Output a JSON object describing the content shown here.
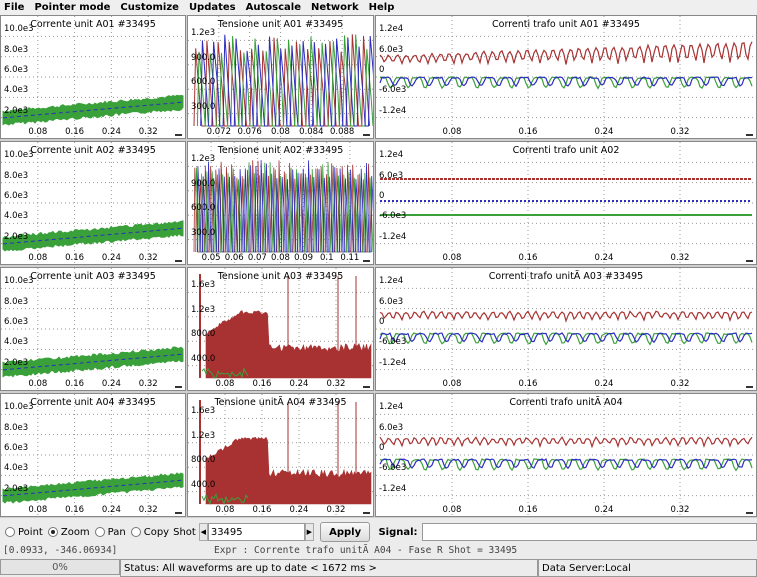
{
  "menu": [
    "File",
    "Pointer mode",
    "Customize",
    "Updates",
    "Autoscale",
    "Network",
    "Help"
  ],
  "colors": {
    "red": "#a83232",
    "green": "#3aa03a",
    "blue": "#2c2cc0",
    "grid": "#999999"
  },
  "plots": [
    {
      "title": "Corrente unit A01  #33495",
      "yticks": [
        "10.0e3",
        "8.0e3",
        "6.0e3",
        "4.0e3",
        "2.0e3"
      ],
      "xticks": [
        "0.08",
        "0.16",
        "0.24",
        "0.32"
      ],
      "kind": "band"
    },
    {
      "title": "Tensione unit A01  #33495",
      "yticks": [
        "1.2e3",
        "900.0",
        "600.0",
        "300.0"
      ],
      "xticks": [
        "0.072",
        "0.076",
        "0.08",
        "0.084",
        "0.088"
      ],
      "kind": "volt1"
    },
    {
      "title": "Correnti trafo unit A01  #33495",
      "yticks": [
        "1.2e4",
        "6.0e3",
        "0",
        "-6.0e3",
        "-1.2e4"
      ],
      "xticks": [
        "0.08",
        "0.16",
        "0.24",
        "0.32"
      ],
      "kind": "trafo"
    },
    {
      "title": "Corrente unit A02  #33495",
      "yticks": [
        "10.0e3",
        "8.0e3",
        "6.0e3",
        "4.0e3",
        "2.0e3"
      ],
      "xticks": [
        "0.08",
        "0.16",
        "0.24",
        "0.32"
      ],
      "kind": "band"
    },
    {
      "title": "Tensione unit A02  #33495",
      "yticks": [
        "1.2e3",
        "900.0",
        "600.0",
        "300.0"
      ],
      "xticks": [
        "0.05",
        "0.06",
        "0.07",
        "0.08",
        "0.09",
        "0.1",
        "0.11"
      ],
      "kind": "volt2"
    },
    {
      "title": "Correnti trafo unit A02",
      "yticks": [
        "1.2e4",
        "6.0e3",
        "0",
        "-6.0e3",
        "-1.2e4"
      ],
      "xticks": [
        "0.08",
        "0.16",
        "0.24",
        "0.32"
      ],
      "kind": "flat"
    },
    {
      "title": "Corrente unit A03  #33495",
      "yticks": [
        "10.0e3",
        "8.0e3",
        "6.0e3",
        "4.0e3",
        "2.0e3"
      ],
      "xticks": [
        "0.08",
        "0.16",
        "0.24",
        "0.32"
      ],
      "kind": "band"
    },
    {
      "title": "Tensione unit A03  #33495",
      "yticks": [
        "1.6e3",
        "1.2e3",
        "800.0",
        "400.0"
      ],
      "xticks": [
        "0.08",
        "0.16",
        "0.24",
        "0.32"
      ],
      "kind": "volt3"
    },
    {
      "title": "Correnti trafo unitÃ  A03  #33495",
      "yticks": [
        "1.2e4",
        "6.0e3",
        "0",
        "-6.0e3",
        "-1.2e4"
      ],
      "xticks": [
        "0.08",
        "0.16",
        "0.24",
        "0.32"
      ],
      "kind": "trafo2"
    },
    {
      "title": "Corrente unit A04  #33495",
      "yticks": [
        "10.0e3",
        "8.0e3",
        "6.0e3",
        "4.0e3",
        "2.0e3"
      ],
      "xticks": [
        "0.08",
        "0.16",
        "0.24",
        "0.32"
      ],
      "kind": "band"
    },
    {
      "title": "Tensione unitÃ  A04  #33495",
      "yticks": [
        "1.6e3",
        "1.2e3",
        "800.0",
        "400.0"
      ],
      "xticks": [
        "0.08",
        "0.16",
        "0.24",
        "0.32"
      ],
      "kind": "volt3"
    },
    {
      "title": "Correnti trafo unitÃ  A04",
      "yticks": [
        "1.2e4",
        "6.0e3",
        "0",
        "-6.0e3",
        "-1.2e4"
      ],
      "xticks": [
        "0.08",
        "0.16",
        "0.24",
        "0.32"
      ],
      "kind": "trafo2"
    }
  ],
  "controls": {
    "modes": [
      "Point",
      "Zoom",
      "Pan",
      "Copy"
    ],
    "selected_mode": "Zoom",
    "shot_label": "Shot",
    "shot_value": "33495",
    "apply_label": "Apply",
    "signal_label": "Signal:",
    "signal_value": ""
  },
  "info": {
    "coords": "[0.0933, -346.06934]",
    "expr": "Expr : Corrente trafo unitÃ  A04 - Fase R Shot = 33495"
  },
  "status": {
    "progress": "0%",
    "progress_fraction": 0,
    "message": "Status: All waveforms are up to date < 1672 ms >",
    "server": "Data Server:Local"
  }
}
